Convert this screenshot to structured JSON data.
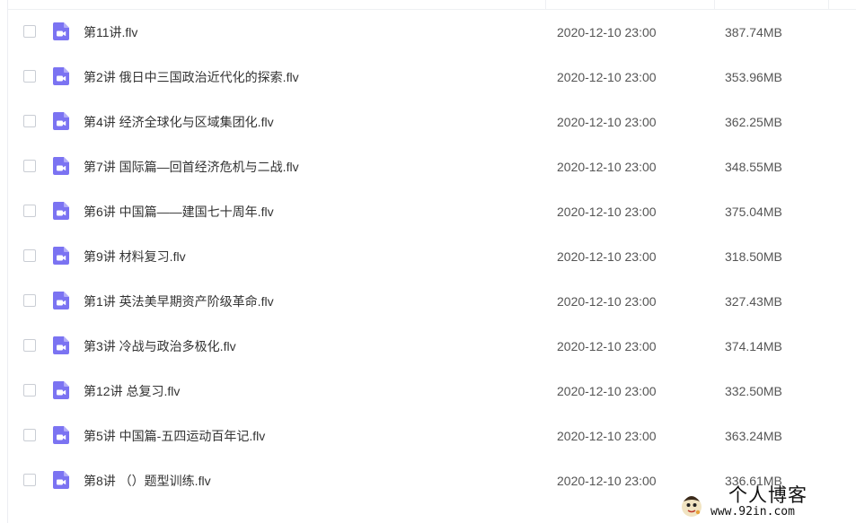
{
  "file_icon": "video-file-icon",
  "colors": {
    "icon_purple": "#7b73f2",
    "checkbox_border": "#c9cdd4",
    "divider": "#eef0f3"
  },
  "files": [
    {
      "name": "第11讲.flv",
      "date": "2020-12-10 23:00",
      "size": "387.74MB"
    },
    {
      "name": "第2讲 俄日中三国政治近代化的探索.flv",
      "date": "2020-12-10 23:00",
      "size": "353.96MB"
    },
    {
      "name": "第4讲 经济全球化与区域集团化.flv",
      "date": "2020-12-10 23:00",
      "size": "362.25MB"
    },
    {
      "name": "第7讲 国际篇—回首经济危机与二战.flv",
      "date": "2020-12-10 23:00",
      "size": "348.55MB"
    },
    {
      "name": "第6讲 中国篇——建国七十周年.flv",
      "date": "2020-12-10 23:00",
      "size": "375.04MB"
    },
    {
      "name": "第9讲 材料复习.flv",
      "date": "2020-12-10 23:00",
      "size": "318.50MB"
    },
    {
      "name": "第1讲 英法美早期资产阶级革命.flv",
      "date": "2020-12-10 23:00",
      "size": "327.43MB"
    },
    {
      "name": "第3讲 冷战与政治多极化.flv",
      "date": "2020-12-10 23:00",
      "size": "374.14MB"
    },
    {
      "name": "第12讲 总复习.flv",
      "date": "2020-12-10 23:00",
      "size": "332.50MB"
    },
    {
      "name": "第5讲 中国篇-五四运动百年记.flv",
      "date": "2020-12-10 23:00",
      "size": "363.24MB"
    },
    {
      "name": "第8讲 （）题型训练.flv",
      "date": "2020-12-10 23:00",
      "size": "336.61MB"
    }
  ],
  "watermark": {
    "title": "个人博客",
    "url": "www.92in.com"
  }
}
